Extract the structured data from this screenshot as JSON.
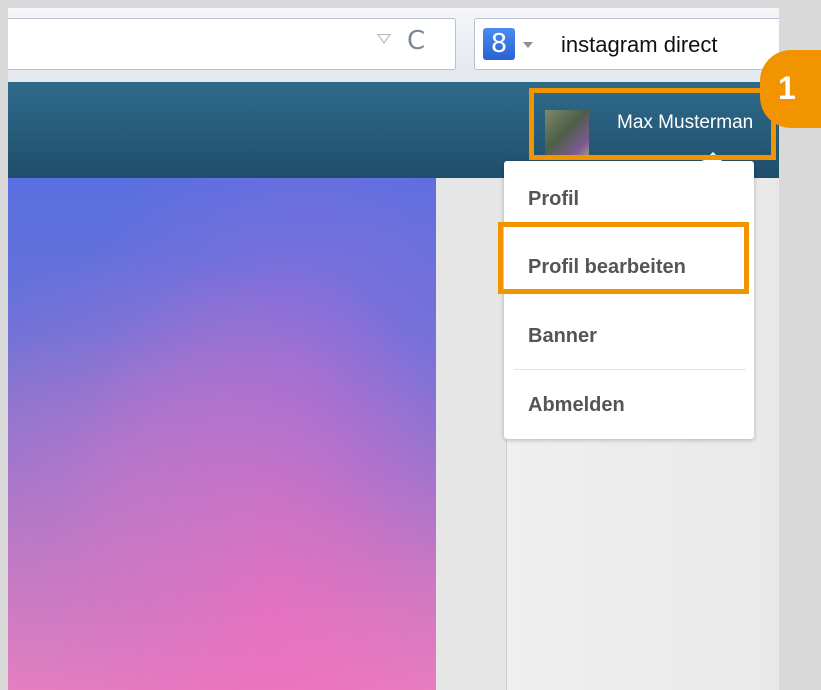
{
  "browser": {
    "search_engine_icon": "google-icon",
    "search_engine_letter": "8",
    "reload_glyph": "C",
    "search_text": "instagram direct"
  },
  "header": {
    "user_name": "Max Musterman"
  },
  "user_menu": {
    "items": [
      {
        "label": "Profil"
      },
      {
        "label": "Profil bearbeiten"
      },
      {
        "label": "Banner"
      },
      {
        "label": "Abmelden"
      }
    ]
  },
  "annotation": {
    "step_number": "1",
    "highlight_color": "#f29400"
  }
}
